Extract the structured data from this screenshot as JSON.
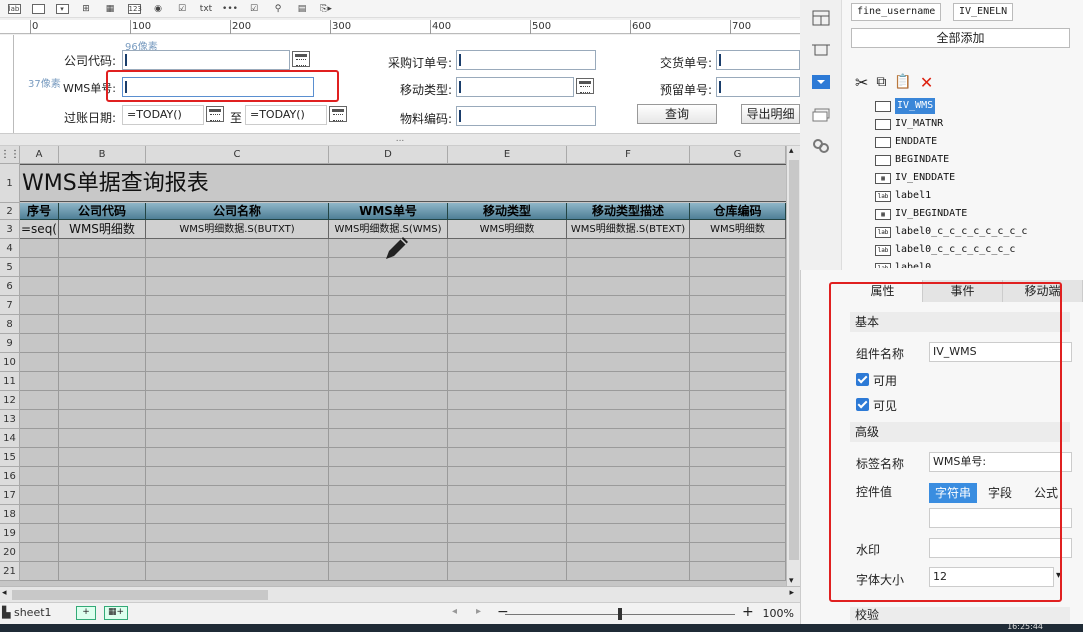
{
  "toolbar": {
    "icons": [
      "label-icon",
      "textbox-icon",
      "dropdown-icon",
      "tree-icon",
      "table-icon",
      "number-icon",
      "radio-group-icon",
      "checkbox-group-icon",
      "text-icon",
      "password-icon",
      "checkbox-icon",
      "org-tree-icon",
      "calendar-icon",
      "export-icon"
    ],
    "lab_text": "lab",
    "num_text": "123",
    "txt_text": "txt"
  },
  "ruler": {
    "labels": [
      "0",
      "100",
      "200",
      "300",
      "400",
      "500",
      "600",
      "700"
    ]
  },
  "params": {
    "company_code_label": "公司代码:",
    "wms_no_label": "WMS单号:",
    "posting_date_label": "过账日期:",
    "date_from_value": "=TODAY()",
    "date_to_label": "至",
    "date_to_value": "=TODAY()",
    "po_no_label": "采购订单号:",
    "movement_type_label": "移动类型:",
    "material_code_label": "物料编码:",
    "delivery_no_label": "交货单号:",
    "reservation_no_label": "预留单号:",
    "query_button": "查询",
    "export_button": "导出明细",
    "width_hint": "96像素",
    "height_hint": "37像素"
  },
  "splitter": "...",
  "sheet": {
    "columns": [
      "A",
      "B",
      "C",
      "D",
      "E",
      "F",
      "G"
    ],
    "rows": [
      "1",
      "2",
      "3",
      "4",
      "5",
      "6",
      "7",
      "8",
      "9",
      "10",
      "11",
      "12",
      "13",
      "14",
      "15",
      "16",
      "17",
      "18",
      "19",
      "20",
      "21"
    ],
    "title": "WMS单据查询报表",
    "headers": [
      "序号",
      "公司代码",
      "公司名称",
      "WMS单号",
      "移动类型",
      "移动类型描述",
      "仓库编码"
    ],
    "data_row": [
      "=seq(",
      "WMS明细数",
      "WMS明细数据.S(BUTXT)",
      "WMS明细数据.S(WMS)",
      "WMS明细数",
      "WMS明细数据.S(BTEXT)",
      "WMS明细数"
    ]
  },
  "status": {
    "sheet_name": "sheet1",
    "zoom": "100%",
    "minus": "−",
    "plus": "+"
  },
  "taskbar": {
    "time": "16:25:44"
  },
  "right": {
    "tag1": "fine_username",
    "tag2": "IV_ENELN",
    "add_all": "全部添加",
    "tree_items": [
      {
        "label": "IV_WMS",
        "icon": "textbox",
        "selected": true
      },
      {
        "label": "IV_MATNR",
        "icon": "textbox",
        "selected": false
      },
      {
        "label": "ENDDATE",
        "icon": "textbox",
        "selected": false
      },
      {
        "label": "BEGINDATE",
        "icon": "textbox",
        "selected": false
      },
      {
        "label": "IV_ENDDATE",
        "icon": "calendar",
        "selected": false
      },
      {
        "label": "label1",
        "icon": "lab",
        "selected": false
      },
      {
        "label": "IV_BEGINDATE",
        "icon": "calendar",
        "selected": false
      },
      {
        "label": "label0_c_c_c_c_c_c_c_c",
        "icon": "lab",
        "selected": false
      },
      {
        "label": "label0_c_c_c_c_c_c_c",
        "icon": "lab",
        "selected": false
      },
      {
        "label": "label0",
        "icon": "lab",
        "selected": false
      }
    ],
    "tabs": [
      "属性",
      "事件",
      "移动端"
    ],
    "basic_section": "基本",
    "widget_name_label": "组件名称",
    "widget_name_value": "IV_WMS",
    "enabled_label": "可用",
    "visible_label": "可见",
    "advanced_section": "高级",
    "label_name_label": "标签名称",
    "label_name_value": "WMS单号:",
    "control_value_label": "控件值",
    "control_value_options": [
      "字符串",
      "字段",
      "公式"
    ],
    "watermark_label": "水印",
    "font_size_label": "字体大小",
    "font_size_value": "12",
    "validation_section": "校验"
  },
  "colors": {
    "accent": "#3a86d8",
    "highlight": "#e02020",
    "header_grad_top": "#8fb6c8",
    "header_grad_bottom": "#4f7f96"
  }
}
